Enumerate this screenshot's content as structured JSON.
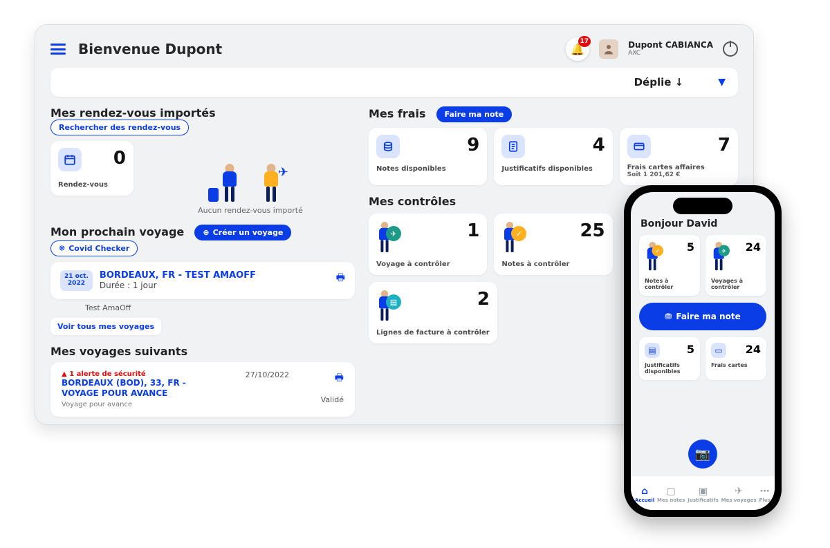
{
  "header": {
    "welcome": "Bienvenue Dupont",
    "notif_count": "17",
    "user_name": "Dupont CABIANCA",
    "user_sub": "AXC"
  },
  "expand": {
    "label": "Déplie ↓"
  },
  "rdv": {
    "title": "Mes rendez-vous importés",
    "search_btn": "Rechercher des rendez-vous",
    "count": "0",
    "label": "Rendez-vous",
    "caption": "Aucun rendez-vous importé"
  },
  "next_trip": {
    "title": "Mon prochain voyage",
    "create_btn": "Créer un voyage",
    "covid_btn": "Covid Checker",
    "date_top": "21 oct.",
    "date_bot": "2022",
    "name": "BORDEAUX, FR - TEST AMAOFF",
    "duration": "Durée : 1 jour",
    "note": "Test AmaOff",
    "all_btn": "Voir tous mes voyages"
  },
  "following": {
    "title": "Mes voyages suivants",
    "alert": "1 alerte de sécurité",
    "name": "BORDEAUX (BOD), 33, FR - VOYAGE POUR AVANCE",
    "date": "27/10/2022",
    "desc": "Voyage pour avance",
    "status": "Validé"
  },
  "frais": {
    "title": "Mes frais",
    "btn": "Faire ma note",
    "cards": [
      {
        "count": "9",
        "label": "Notes disponibles"
      },
      {
        "count": "4",
        "label": "Justificatifs disponibles"
      },
      {
        "count": "7",
        "label": "Frais cartes affaires",
        "sub": "Soit 1 201,62 €"
      }
    ]
  },
  "controls": {
    "title": "Mes contrôles",
    "cards": [
      {
        "count": "1",
        "label": "Voyage à contrôler"
      },
      {
        "count": "25",
        "label": "Notes à contrôler"
      },
      {
        "count": "2",
        "label": "Lignes de facture à contrôler"
      }
    ]
  },
  "phone": {
    "greeting": "Bonjour David",
    "row1": [
      {
        "count": "5",
        "label": "Notes à contrôler"
      },
      {
        "count": "24",
        "label": "Voyages à contrôler"
      }
    ],
    "main_btn": "Faire ma note",
    "row2": [
      {
        "count": "5",
        "label": "Justificatifs disponibles"
      },
      {
        "count": "24",
        "label": "Frais cartes"
      }
    ],
    "tabs": [
      "Accueil",
      "Mes notes",
      "Justificatifs",
      "Mes voyages",
      "Plus"
    ]
  }
}
